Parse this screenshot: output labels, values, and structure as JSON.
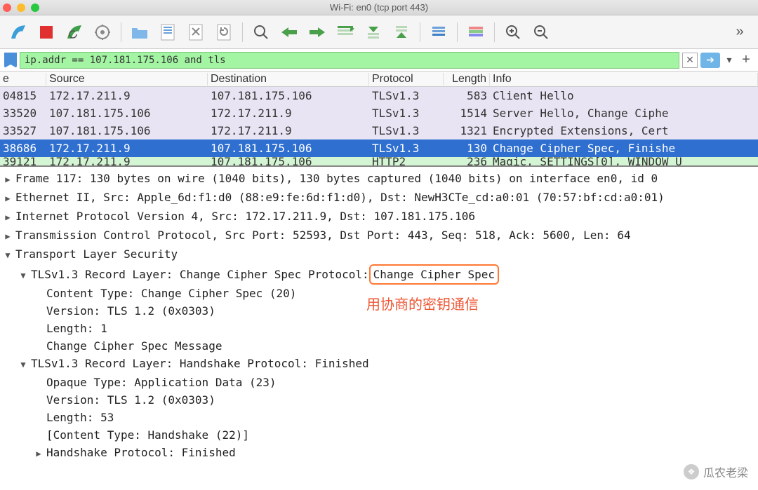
{
  "window": {
    "title": "Wi-Fi: en0 (tcp port 443)"
  },
  "filter": {
    "value": "ip.addr == 107.181.175.106 and tls"
  },
  "columns": {
    "no": "e",
    "src": "Source",
    "dst": "Destination",
    "proto": "Protocol",
    "len": "Length",
    "info": "Info"
  },
  "packets": [
    {
      "no": "04815",
      "src": "172.17.211.9",
      "dst": "107.181.175.106",
      "proto": "TLSv1.3",
      "len": "583",
      "info": "Client Hello",
      "cls": "row-lavender"
    },
    {
      "no": "33520",
      "src": "107.181.175.106",
      "dst": "172.17.211.9",
      "proto": "TLSv1.3",
      "len": "1514",
      "info": "Server Hello, Change Ciphe",
      "cls": "row-lavender"
    },
    {
      "no": "33527",
      "src": "107.181.175.106",
      "dst": "172.17.211.9",
      "proto": "TLSv1.3",
      "len": "1321",
      "info": "Encrypted Extensions, Cert",
      "cls": "row-lavender"
    },
    {
      "no": "38686",
      "src": "172.17.211.9",
      "dst": "107.181.175.106",
      "proto": "TLSv1.3",
      "len": "130",
      "info": "Change Cipher Spec, Finishe",
      "cls": "row-selected"
    },
    {
      "no": "39121",
      "src": "172.17.211.9",
      "dst": "107.181.175.106",
      "proto": "HTTP2",
      "len": "236",
      "info": "Magic, SETTINGS[0], WINDOW_U",
      "cls": "row-green row-partial"
    }
  ],
  "details": {
    "frame": "Frame 117: 130 bytes on wire (1040 bits), 130 bytes captured (1040 bits) on interface en0, id 0",
    "eth": "Ethernet II, Src: Apple_6d:f1:d0 (88:e9:fe:6d:f1:d0), Dst: NewH3CTe_cd:a0:01 (70:57:bf:cd:a0:01)",
    "ip": "Internet Protocol Version 4, Src: 172.17.211.9, Dst: 107.181.175.106",
    "tcp": "Transmission Control Protocol, Src Port: 52593, Dst Port: 443, Seq: 518, Ack: 5600, Len: 64",
    "tls": "Transport Layer Security",
    "rec1_pre": "TLSv1.3 Record Layer: Change Cipher Spec Protocol: ",
    "rec1_box": "Change Cipher Spec",
    "rec1_a": "Content Type: Change Cipher Spec (20)",
    "rec1_b": "Version: TLS 1.2 (0x0303)",
    "rec1_c": "Length: 1",
    "rec1_d": "Change Cipher Spec Message",
    "rec2": "TLSv1.3 Record Layer: Handshake Protocol: Finished",
    "rec2_a": "Opaque Type: Application Data (23)",
    "rec2_b": "Version: TLS 1.2 (0x0303)",
    "rec2_c": "Length: 53",
    "rec2_d": "[Content Type: Handshake (22)]",
    "rec2_e": "Handshake Protocol: Finished"
  },
  "annotation": "用协商的密钥通信",
  "watermark": "瓜农老梁"
}
